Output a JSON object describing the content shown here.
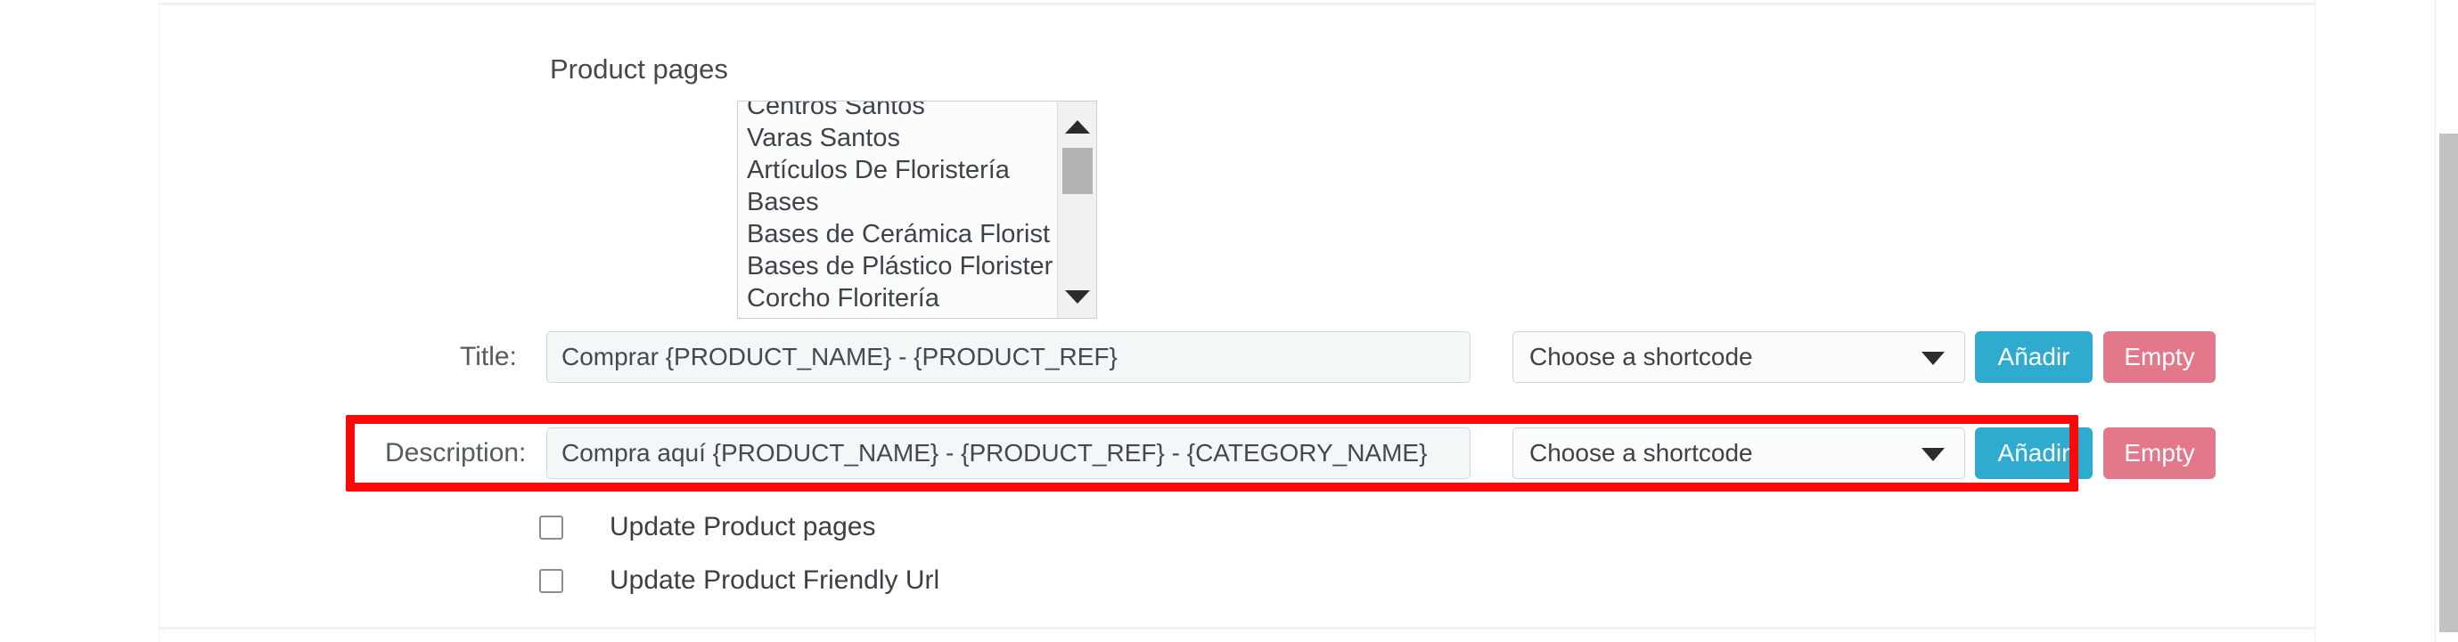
{
  "form": {
    "product_pages": {
      "label": "Product pages",
      "options": [
        "Centros Santos",
        "Varas Santos",
        "Artículos De Floristería",
        "Bases",
        "Bases de Cerámica Florist",
        "Bases de Plástico Florister",
        "Corcho Floritería"
      ]
    },
    "title_row": {
      "label": "Title:",
      "value": "Comprar {PRODUCT_NAME} - {PRODUCT_REF}",
      "shortcode_selected": "Choose a shortcode",
      "add_label": "Añadir",
      "empty_label": "Empty"
    },
    "description_row": {
      "label": "Description:",
      "value": "Compra aquí {PRODUCT_NAME} - {PRODUCT_REF} - {CATEGORY_NAME}",
      "shortcode_selected": "Choose a shortcode",
      "add_label": "Añadir",
      "empty_label": "Empty"
    },
    "checkboxes": [
      {
        "label": "Update Product pages",
        "checked": false
      },
      {
        "label": "Update Product Friendly Url",
        "checked": false
      }
    ]
  },
  "colors": {
    "add_button": "#2fabcf",
    "empty_button": "#e3788b",
    "highlight": "#fb0808",
    "input_background": "#f3f7f7",
    "text": "#3c4045"
  }
}
